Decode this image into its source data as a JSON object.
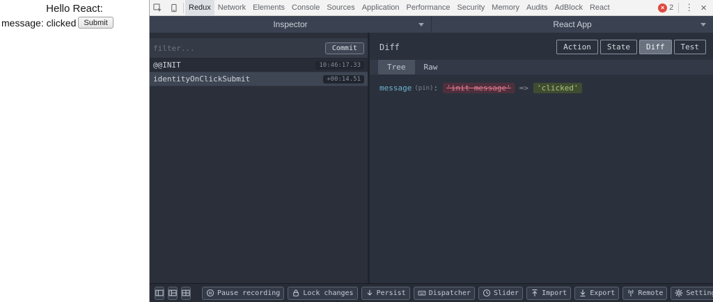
{
  "webpage": {
    "title": "Hello React:",
    "message": "message: clicked",
    "submit_label": "Submit"
  },
  "devtools_topbar": {
    "tabs": [
      "Redux",
      "Network",
      "Elements",
      "Console",
      "Sources",
      "Application",
      "Performance",
      "Security",
      "Memory",
      "Audits",
      "AdBlock",
      "React"
    ],
    "selected_tab": "Redux",
    "error_count": "2",
    "icons": {
      "error_glyph": "×",
      "kebab": "⋮",
      "close": "×"
    }
  },
  "monitor_bar": {
    "inspector_label": "Inspector",
    "app_label": "React App"
  },
  "action_list": {
    "filter_placeholder": "filter...",
    "commit_label": "Commit",
    "actions": [
      {
        "name": "@@INIT",
        "time": "10:46:17.33",
        "selected": false
      },
      {
        "name": "identityOnClickSubmit",
        "time": "+00:14.51",
        "selected": true
      }
    ]
  },
  "detail_panel": {
    "title": "Diff",
    "mode_buttons": [
      "Action",
      "State",
      "Diff",
      "Test"
    ],
    "selected_mode": "Diff",
    "view_tabs": [
      "Tree",
      "Raw"
    ],
    "selected_view": "Tree",
    "diff": {
      "key": "message",
      "pin_label": "(pin)",
      "colon": ":",
      "removed_value": "'init message'",
      "arrow": "=>",
      "added_value": "'clicked'"
    }
  },
  "bottom_toolbar": {
    "buttons": [
      "Pause recording",
      "Lock changes",
      "Persist",
      "Dispatcher",
      "Slider",
      "Import",
      "Export",
      "Remote",
      "Settings"
    ]
  },
  "colors": {
    "accent_removed_bg": "#4e2f3c",
    "accent_added_bg": "#3f4c31",
    "error_red": "#df4a3f",
    "panel_bg": "#2a2f3a"
  }
}
